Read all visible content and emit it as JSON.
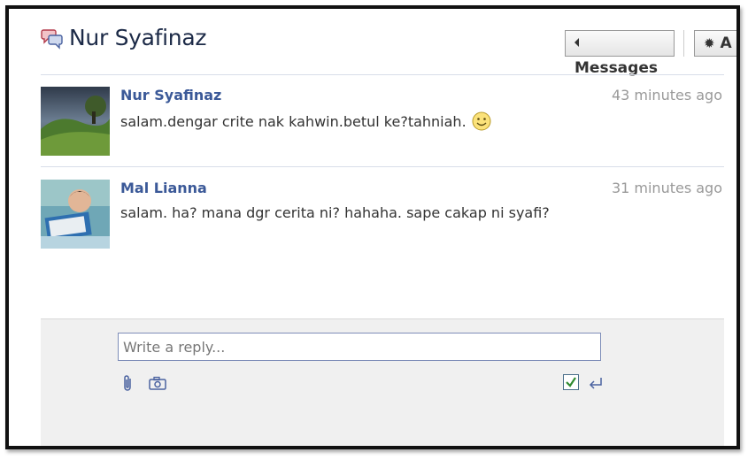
{
  "header": {
    "title": "Nur Syafinaz",
    "messages_button": "Messages",
    "actions_button": "A"
  },
  "messages": [
    {
      "author": "Nur Syafinaz",
      "time": "43 minutes ago",
      "text": "salam.dengar crite nak kahwin.betul ke?tahniah.",
      "emoticon": "smiley-icon"
    },
    {
      "author": "Mal Lianna",
      "time": "31 minutes ago",
      "text": "salam. ha? mana dgr cerita ni? hahaha. sape cakap ni syafi?"
    }
  ],
  "reply": {
    "placeholder": "Write a reply...",
    "value": "",
    "enter_to_send_checked": true
  },
  "icons": {
    "title": "chat-bubbles-icon",
    "attach": "paperclip-icon",
    "photo": "camera-icon",
    "send": "enter-arrow-icon",
    "gear": "gear-icon"
  },
  "colors": {
    "link": "#3b5998",
    "title": "#1c2a47",
    "timestamp": "#999999",
    "reply_bg": "#f0f0f0"
  }
}
